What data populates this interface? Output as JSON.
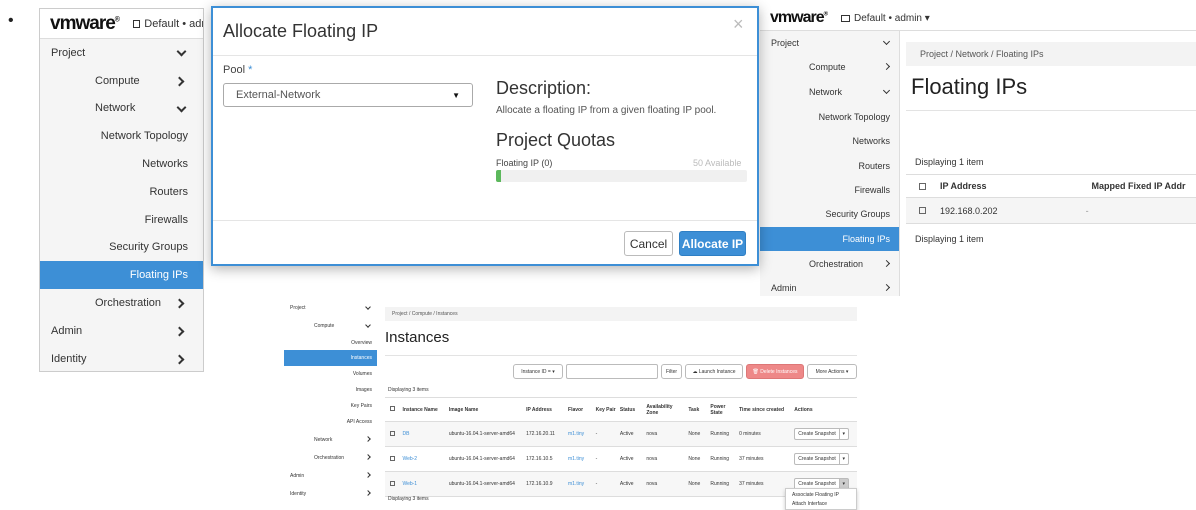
{
  "bullet": "•",
  "brand": {
    "logo_vm": "vm",
    "logo_ware": "ware",
    "reg": "®"
  },
  "panel1": {
    "user_dropdown": "Default • adr",
    "nav": [
      {
        "label": "Project",
        "indent": 0,
        "chev": "down"
      },
      {
        "label": "Compute",
        "indent": 1,
        "chev": "right"
      },
      {
        "label": "Network",
        "indent": 1,
        "chev": "down"
      },
      {
        "label": "Network Topology",
        "indent": 2
      },
      {
        "label": "Networks",
        "indent": 2
      },
      {
        "label": "Routers",
        "indent": 2
      },
      {
        "label": "Firewalls",
        "indent": 2
      },
      {
        "label": "Security Groups",
        "indent": 2
      },
      {
        "label": "Floating IPs",
        "indent": 2,
        "active": true
      },
      {
        "label": "Orchestration",
        "indent": 1,
        "chev": "right"
      },
      {
        "label": "Admin",
        "indent": 0,
        "chev": "right"
      },
      {
        "label": "Identity",
        "indent": 0,
        "chev": "right"
      }
    ]
  },
  "modal": {
    "title": "Allocate Floating IP",
    "close": "×",
    "pool_label": "Pool",
    "required_mark": "*",
    "pool_value": "External-Network",
    "desc_heading": "Description:",
    "desc_text": "Allocate a floating IP from a given floating IP pool.",
    "quota_heading": "Project Quotas",
    "quota_label": "Floating IP (0)",
    "quota_available": "50 Available",
    "quota_used_fraction": 0.02,
    "cancel": "Cancel",
    "allocate": "Allocate IP"
  },
  "panel2": {
    "user_dropdown": "Default • admin ▾",
    "nav": [
      {
        "label": "Project",
        "chev": "down"
      },
      {
        "label": "Compute",
        "chev": "right"
      },
      {
        "label": "Network",
        "chev": "down"
      },
      {
        "label": "Network Topology"
      },
      {
        "label": "Networks"
      },
      {
        "label": "Routers"
      },
      {
        "label": "Firewalls"
      },
      {
        "label": "Security Groups"
      },
      {
        "label": "Floating IPs",
        "active": true
      },
      {
        "label": "Orchestration",
        "chev": "right"
      },
      {
        "label": "Admin",
        "chev": "right"
      }
    ],
    "breadcrumb": "Project / Network / Floating IPs",
    "page_title": "Floating IPs",
    "displaying_top": "Displaying 1 item",
    "col_ip": "IP Address",
    "col_mapped": "Mapped Fixed IP Addr",
    "row_ip": "192.168.0.202",
    "row_mapped": "-",
    "displaying_bottom": "Displaying 1 item"
  },
  "panel3": {
    "nav": [
      {
        "label": "Project",
        "chev": "down",
        "lvl": 0
      },
      {
        "label": "Compute",
        "chev": "down",
        "lvl": 1
      },
      {
        "label": "Overview",
        "lvl": 2
      },
      {
        "label": "Instances",
        "lvl": 2,
        "active": true
      },
      {
        "label": "Volumes",
        "lvl": 2
      },
      {
        "label": "Images",
        "lvl": 2
      },
      {
        "label": "Key Pairs",
        "lvl": 2
      },
      {
        "label": "API Access",
        "lvl": 2
      },
      {
        "label": "Network",
        "chev": "right",
        "lvl": 1
      },
      {
        "label": "Orchestration",
        "chev": "right",
        "lvl": 1
      },
      {
        "label": "Admin",
        "chev": "right",
        "lvl": 0
      },
      {
        "label": "Identity",
        "chev": "right",
        "lvl": 0
      }
    ],
    "breadcrumb": "Project / Compute / Instances",
    "page_title": "Instances",
    "filter_select": "Instance ID = ▾",
    "filter_btn": "Filter",
    "launch_btn": "☁ Launch Instance",
    "delete_btn": "🗑 Delete Instances",
    "more_btn": "More Actions ▾",
    "displaying_top": "Displaying 3 items",
    "columns": [
      "Instance Name",
      "Image Name",
      "IP Address",
      "Flavor",
      "Key Pair",
      "Status",
      "Availability Zone",
      "Task",
      "Power State",
      "Time since created",
      "Actions"
    ],
    "rows": [
      {
        "name": "DB",
        "image": "ubuntu-16.04.1-server-amd64",
        "ip": "172.16.20.11",
        "flavor": "m1.tiny",
        "key": "-",
        "status": "Active",
        "zone": "nova",
        "task": "None",
        "power": "Running",
        "time": "0 minutes",
        "action": "Create Snapshot"
      },
      {
        "name": "Web-2",
        "image": "ubuntu-16.04.1-server-amd64",
        "ip": "172.16.10.5",
        "flavor": "m1.tiny",
        "key": "-",
        "status": "Active",
        "zone": "nova",
        "task": "None",
        "power": "Running",
        "time": "37 minutes",
        "action": "Create Snapshot"
      },
      {
        "name": "Web-1",
        "image": "ubuntu-16.04.1-server-amd64",
        "ip": "172.16.10.9",
        "flavor": "m1.tiny",
        "key": "-",
        "status": "Active",
        "zone": "nova",
        "task": "None",
        "power": "Running",
        "time": "37 minutes",
        "action": "Create Snapshot"
      }
    ],
    "displaying_bottom": "Displaying 3 items",
    "menu_items": [
      "Associate Floating IP",
      "Attach Interface"
    ]
  }
}
